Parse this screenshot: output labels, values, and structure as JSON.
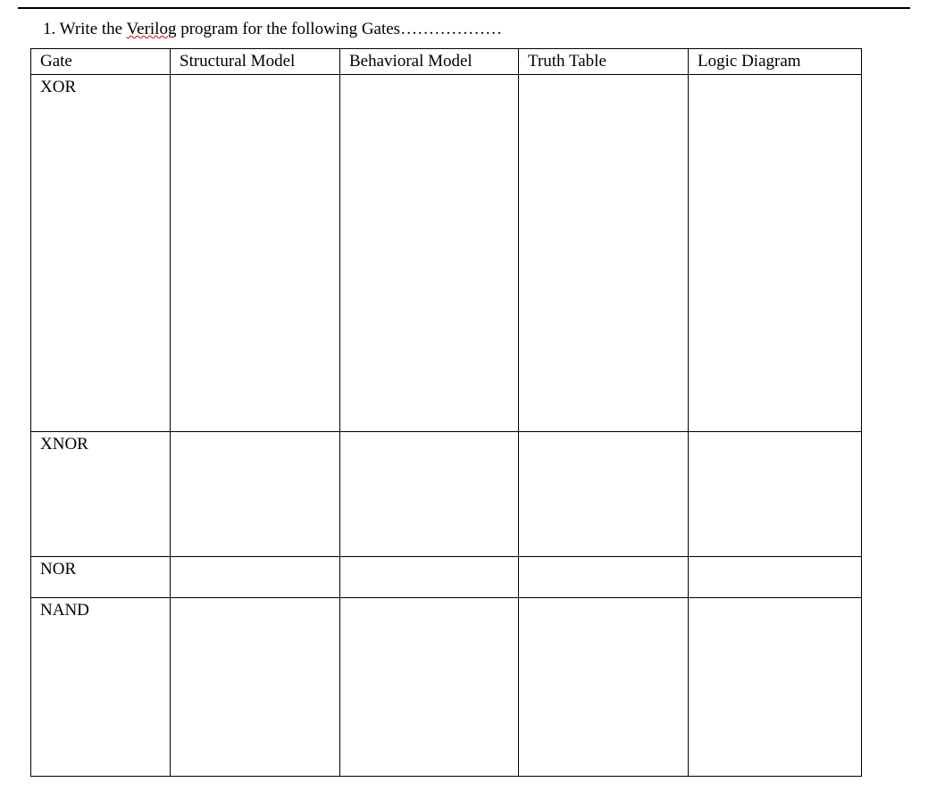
{
  "prompt": {
    "number": "1.",
    "before": " Write the ",
    "spellcheck_word": "Verilog",
    "after": " program for the following Gates………………"
  },
  "table": {
    "headers": [
      "Gate",
      "Structural Model",
      "Behavioral Model",
      "Truth Table",
      "Logic Diagram"
    ],
    "rows": [
      {
        "gate": "XOR",
        "structural": "",
        "behavioral": "",
        "truth": "",
        "diagram": ""
      },
      {
        "gate": "XNOR",
        "structural": "",
        "behavioral": "",
        "truth": "",
        "diagram": ""
      },
      {
        "gate": "NOR",
        "structural": "",
        "behavioral": "",
        "truth": "",
        "diagram": ""
      },
      {
        "gate": "NAND",
        "structural": "",
        "behavioral": "",
        "truth": "",
        "diagram": ""
      }
    ]
  }
}
